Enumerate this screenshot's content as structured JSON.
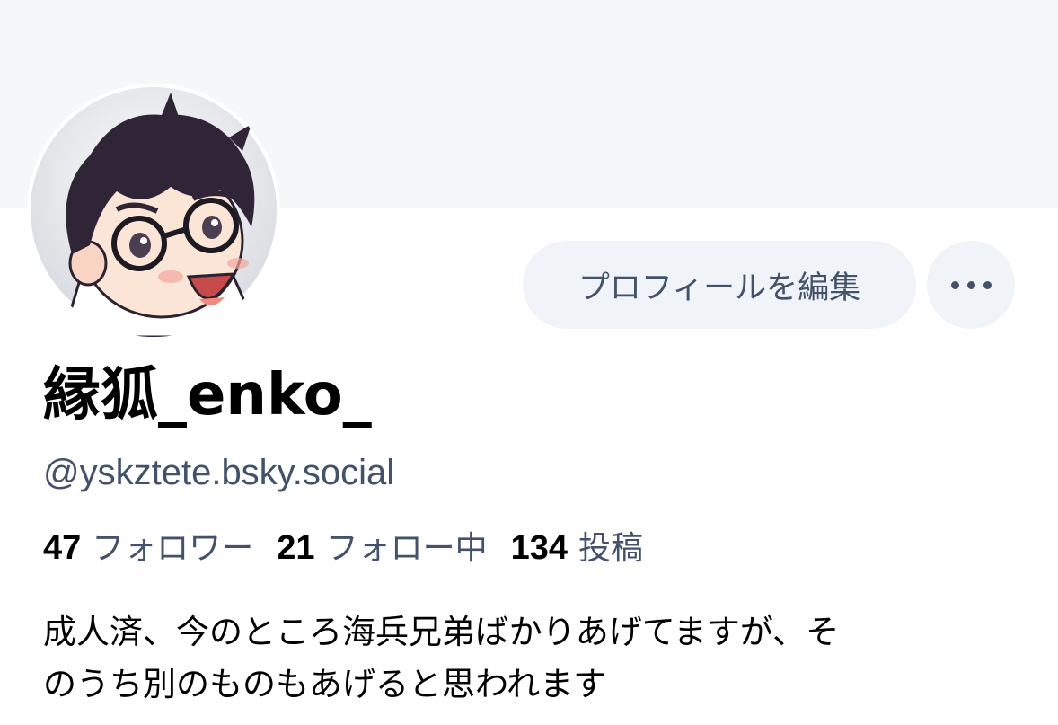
{
  "profile": {
    "display_name": "縁狐_enko_",
    "handle": "@yskztete.bsky.social",
    "avatar_icon": "avatar-illustration-icon",
    "bio_lines": [
      "成人済、今のところ海兵兄弟ばかりあげてますが、そ",
      "のうち別のものもあげると思われます"
    ]
  },
  "actions": {
    "edit_profile_label": "プロフィールを編集",
    "more_icon": "ellipsis-icon"
  },
  "stats": {
    "followers_count": "47",
    "followers_label": "フォロワー",
    "following_count": "21",
    "following_label": "フォロー中",
    "posts_count": "134",
    "posts_label": "投稿"
  },
  "colors": {
    "banner": "#f5f7f9",
    "button_bg": "#f0f3f7",
    "secondary_text": "#43526a",
    "primary_text": "#000000"
  }
}
